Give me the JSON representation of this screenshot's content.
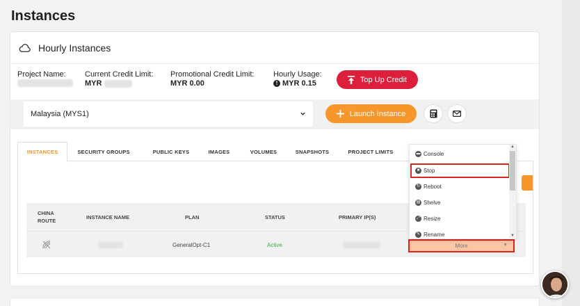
{
  "page": {
    "title": "Instances"
  },
  "card": {
    "title": "Hourly Instances"
  },
  "stats": {
    "project_name_label": "Project Name:",
    "credit_limit_label": "Current Credit Limit:",
    "credit_limit_currency": "MYR",
    "promo_label": "Promotional Credit Limit:",
    "promo_value": "MYR 0.00",
    "usage_label": "Hourly Usage:",
    "usage_value": "MYR 0.15"
  },
  "buttons": {
    "top_up": "Top Up Credit",
    "launch": "Launch Instance"
  },
  "region": {
    "selected": "Malaysia (MYS1)"
  },
  "tabs": [
    {
      "label": "INSTANCES",
      "active": true
    },
    {
      "label": "SECURITY GROUPS"
    },
    {
      "label": "PUBLIC KEYS"
    },
    {
      "label": "IMAGES"
    },
    {
      "label": "VOLUMES"
    },
    {
      "label": "SNAPSHOTS"
    },
    {
      "label": "PROJECT LIMITS"
    }
  ],
  "table": {
    "headers": [
      "CHINA ROUTE",
      "INSTANCE NAME",
      "PLAN",
      "STATUS",
      "PRIMARY IP(S)"
    ],
    "rows": [
      {
        "plan": "GeneralOpt-C1",
        "status": "Active",
        "action": "More"
      }
    ]
  },
  "menu": {
    "items": [
      "Console",
      "Stop",
      "Reboot",
      "Shelve",
      "Resize",
      "Rename"
    ]
  },
  "colors": {
    "accent_orange": "#f7972b",
    "danger_red": "#dc1f3c",
    "status_green": "#3cb043",
    "highlight_red": "#d9261c"
  }
}
